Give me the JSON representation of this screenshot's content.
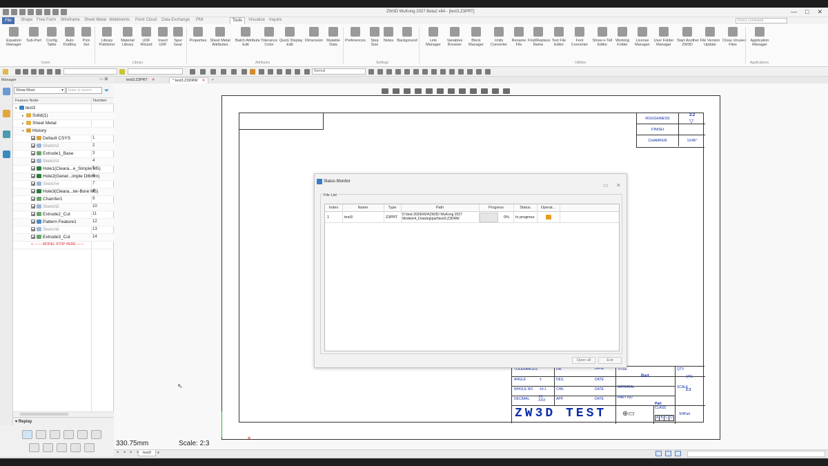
{
  "window": {
    "title": "ZW3D WuKong 2027 Beta2 x64 - [test3.Z3PRT]",
    "controls": [
      "—",
      "□",
      "✕"
    ]
  },
  "menu_tabs": [
    "File",
    "Shape",
    "Free Form",
    "Wireframe",
    "Sheet Metal",
    "Weldments",
    "Point Cloud",
    "Data Exchange",
    "PMI",
    "Tools",
    "Visualize",
    "Inquire"
  ],
  "active_menu_tab": "Tools",
  "find_command_placeholder": "Find a command",
  "ribbon": {
    "buttons": [
      {
        "label": "Equation\nManager"
      },
      {
        "label": "Sub-Part"
      },
      {
        "label": "Config\nTable"
      },
      {
        "label": "Auto\nDraftiny"
      },
      {
        "label": "Pick\nSet"
      },
      {
        "label": "Library\nPublisher"
      },
      {
        "label": "Material\nLibrary"
      },
      {
        "label": "UDF\nWizard"
      },
      {
        "label": "Insert\nUDF"
      },
      {
        "label": "Spur\nGear"
      },
      {
        "label": "Properties"
      },
      {
        "label": "Sheet Metal\nAttributes"
      },
      {
        "label": "Batch Attribute\nEdit"
      },
      {
        "label": "Tolerance\nColor"
      },
      {
        "label": "Quick Display\nEdit"
      },
      {
        "label": "Dimension"
      },
      {
        "label": "Mutable\nData"
      },
      {
        "label": "Preferences"
      },
      {
        "label": "Step\nSize"
      },
      {
        "label": "Notes"
      },
      {
        "label": "Background"
      },
      {
        "label": "Link\nManager"
      },
      {
        "label": "Variables\nBrowser"
      },
      {
        "label": "Block\nManager"
      },
      {
        "label": "Units\nConverter"
      },
      {
        "label": "Rename\nFile"
      },
      {
        "label": "Find/Replace\nName"
      },
      {
        "label": "Text File\nEditor"
      },
      {
        "label": "Font\nConverter"
      },
      {
        "label": "Show-n-Tell\nEditor"
      },
      {
        "label": "Working\nFolder"
      },
      {
        "label": "License\nManager"
      },
      {
        "label": "User Folder\nManager"
      },
      {
        "label": "Start Another\nZW3D"
      },
      {
        "label": "File Version\nUpdate"
      },
      {
        "label": "Close Unused\nFiles"
      },
      {
        "label": "Application\nManager"
      }
    ],
    "groups": [
      "Insert",
      "Library",
      "Attributes",
      "Settings",
      "Utilities",
      "Applications"
    ]
  },
  "toolbar2": {
    "style_combo": "Normal"
  },
  "manager": {
    "title": "Manager",
    "filter": "Show Most",
    "search_placeholder": "Enter to search",
    "columns": [
      "Feature Node",
      "Number"
    ],
    "tree": [
      {
        "label": "test3",
        "number": "",
        "kind": "root"
      },
      {
        "label": "Solid(1)",
        "number": "",
        "kind": "group"
      },
      {
        "label": "Sheet Metal",
        "number": "",
        "kind": "group"
      },
      {
        "label": "History",
        "number": "",
        "kind": "history"
      },
      {
        "label": "Default CSYS",
        "number": "1",
        "kind": "csys"
      },
      {
        "label": "Sketch2",
        "number": "2",
        "kind": "sketch"
      },
      {
        "label": "Extrude1_Base",
        "number": "3",
        "kind": "feature"
      },
      {
        "label": "Sketch3",
        "number": "4",
        "kind": "sketch"
      },
      {
        "label": "Hole1(Cleara...e_Simple M5)",
        "number": "5",
        "kind": "hole"
      },
      {
        "label": "Hole2(Gener...imple Dl6mm)",
        "number": "6",
        "kind": "hole"
      },
      {
        "label": "Sketch4",
        "number": "7",
        "kind": "sketch"
      },
      {
        "label": "Hole3(Cleara...ter-Bore M5)",
        "number": "8",
        "kind": "hole"
      },
      {
        "label": "Chamfer1",
        "number": "9",
        "kind": "feature"
      },
      {
        "label": "Sketch5",
        "number": "10",
        "kind": "sketch"
      },
      {
        "label": "Extrude2_Cut",
        "number": "11",
        "kind": "feature"
      },
      {
        "label": "Pattern Feature1",
        "number": "12",
        "kind": "pattern"
      },
      {
        "label": "Sketch6",
        "number": "13",
        "kind": "sketch"
      },
      {
        "label": "Extrude3_Cut",
        "number": "14",
        "kind": "feature"
      },
      {
        "label": "------ MODEL STOP HERE ------",
        "number": "",
        "kind": "stop"
      }
    ],
    "replay_title": "Replay"
  },
  "doc_tabs": [
    {
      "label": "test3.Z3PRT",
      "active": false
    },
    {
      "label": "* test3.Z3DRW",
      "active": true
    }
  ],
  "drawing": {
    "roughness_table": [
      {
        "label": "ROUGHNESS",
        "value": "3.2"
      },
      {
        "label": "FINISH",
        "value": ""
      },
      {
        "label": "CHAMFER",
        "value": "1X45°"
      }
    ],
    "title_block": {
      "tolerances": "TOLERANCES",
      "angle": "ANGLE",
      "angle_val": "±",
      "whole_no": "WHOLE NO",
      "whole_val": "±0.1",
      "decimal": "DECIMAL",
      "decimal_val": ".X1\n.XXX",
      "dr": "DR.",
      "des": "DES.",
      "chk": "CHK.",
      "app": "APP.",
      "date": "DATE",
      "title_label": "TITLE",
      "title_val": "Part",
      "qty_label": "QTY.",
      "qty_val": "1PC",
      "material_label": "MATERIAL",
      "scale_label": "SCALE",
      "scale_val": "2:3",
      "partno_label": "PART NO",
      "partno_val": "Part",
      "class_label": "CLASS",
      "class_cells": [
        "A",
        "B",
        "C",
        "D"
      ],
      "sheet_val": "SHPart",
      "brand": "ZW3D  TEST"
    }
  },
  "coordinates": "330.75mm",
  "scale_readout": "Scale: 2:3",
  "sheet_tab": "test3",
  "status_monitor": {
    "title": "Status Monitor",
    "file_list_label": "File List",
    "columns": [
      "Index",
      "Name",
      "Type",
      "Path",
      "Progress",
      "Status",
      "Operat..."
    ],
    "rows": [
      {
        "index": "1",
        "name": "test3",
        "type": "Z3PRT",
        "path": "D:\\test-20260424\\ZW3D WuKong 2027\nModels\\4_Drawing\\part\\test3.Z3DRW",
        "progress": "0%",
        "progress_value": 0,
        "status": "In progress"
      }
    ],
    "buttons": {
      "open_all": "Open all",
      "exit": "Exit"
    }
  },
  "colors": {
    "drawing_text": "#0b2ba8",
    "file_tab": "#4a6fb0",
    "stop_line": "#dd2222",
    "green_axis": "#2db53d"
  }
}
